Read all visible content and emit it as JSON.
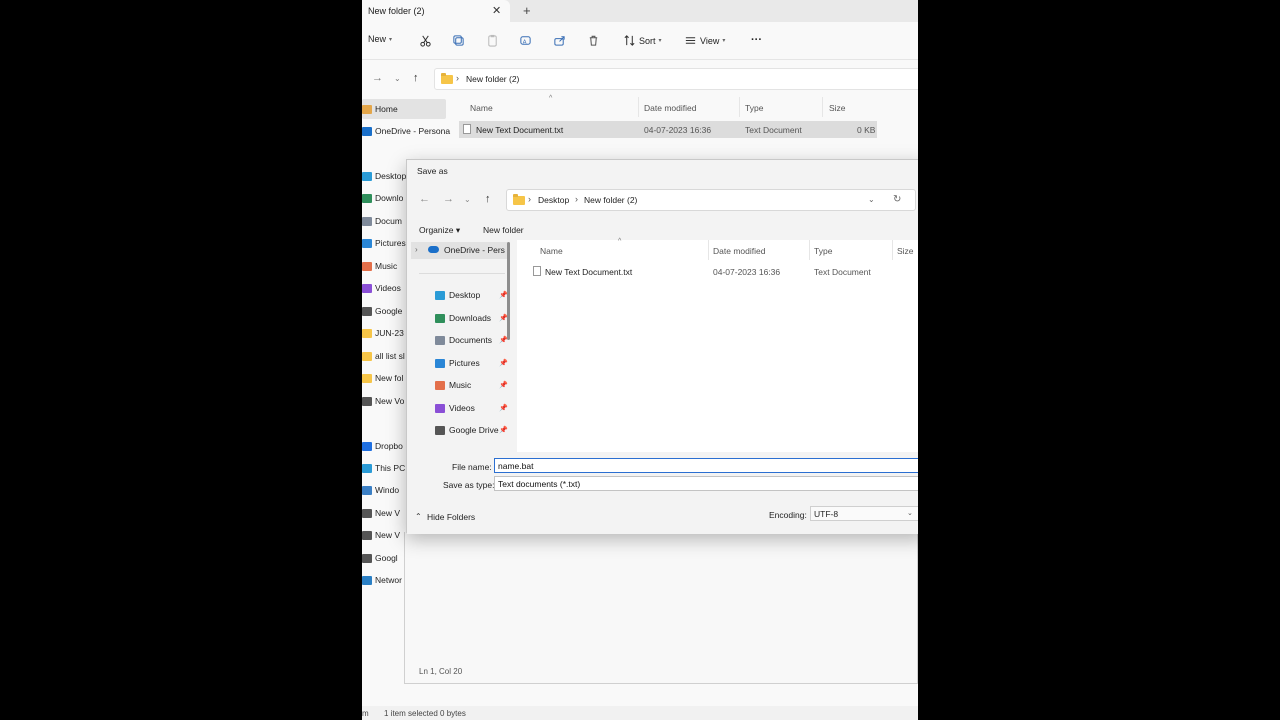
{
  "explorer": {
    "tab_title": "New folder (2)",
    "tab_close": "✕",
    "tab_add": "+",
    "toolbar": {
      "new_label": "New",
      "sort_label": "Sort",
      "view_label": "View",
      "more_label": "···"
    },
    "address": {
      "path": [
        "New folder (2)"
      ]
    },
    "nav": [
      {
        "label": "Home",
        "icon": "home-icon",
        "color": "#e3a64a"
      },
      {
        "label": "OneDrive - Persona",
        "icon": "cloud-icon",
        "color": "#1a6fc9"
      },
      {
        "label": "Desktop",
        "icon": "desktop-icon",
        "color": "#2a9bd6"
      },
      {
        "label": "Downlo",
        "icon": "download-icon",
        "color": "#2f8f5b"
      },
      {
        "label": "Docum",
        "icon": "documents-icon",
        "color": "#7f8a9a"
      },
      {
        "label": "Pictures",
        "icon": "pictures-icon",
        "color": "#2a86d6"
      },
      {
        "label": "Music",
        "icon": "music-icon",
        "color": "#e36f4a"
      },
      {
        "label": "Videos",
        "icon": "videos-icon",
        "color": "#8a4fd6"
      },
      {
        "label": "Google",
        "icon": "drive-icon",
        "color": "#555555"
      },
      {
        "label": "JUN-23",
        "icon": "folder-icon",
        "color": "#f6c548"
      },
      {
        "label": "all list sl",
        "icon": "folder-icon",
        "color": "#f6c548"
      },
      {
        "label": "New fol",
        "icon": "folder-icon",
        "color": "#f6c548"
      },
      {
        "label": "New Vo",
        "icon": "drive-icon",
        "color": "#555555"
      },
      {
        "label": "Dropbo",
        "icon": "dropbox-icon",
        "color": "#1f6fe0"
      },
      {
        "label": "This PC",
        "icon": "pc-icon",
        "color": "#2a9bd6"
      },
      {
        "label": "Windo",
        "icon": "windows-icon",
        "color": "#3b7fc4"
      },
      {
        "label": "New V",
        "icon": "drive-icon",
        "color": "#555555"
      },
      {
        "label": "New V",
        "icon": "drive-icon",
        "color": "#555555"
      },
      {
        "label": "Googl",
        "icon": "drive-icon",
        "color": "#555555"
      },
      {
        "label": "Networ",
        "icon": "network-icon",
        "color": "#2a7fc4"
      }
    ],
    "columns": [
      "Name",
      "Date modified",
      "Type",
      "Size"
    ],
    "files": [
      {
        "name": "New Text Document.txt",
        "date": "04-07-2023 16:36",
        "type": "Text Document",
        "size": "0 KB"
      }
    ],
    "status": {
      "left": "m",
      "selected": "1 item selected 0 bytes"
    }
  },
  "dialog": {
    "title": "Save as",
    "breadcrumb": [
      "Desktop",
      "New folder (2)"
    ],
    "organize_label": "Organize ▾",
    "new_folder_label": "New folder",
    "onedrive_label": "OneDrive - Pers",
    "nav": [
      {
        "label": "Desktop",
        "icon": "desktop-icon",
        "color": "#2a9bd6"
      },
      {
        "label": "Downloads",
        "icon": "download-icon",
        "color": "#2f8f5b"
      },
      {
        "label": "Documents",
        "icon": "documents-icon",
        "color": "#7f8a9a"
      },
      {
        "label": "Pictures",
        "icon": "pictures-icon",
        "color": "#2a86d6"
      },
      {
        "label": "Music",
        "icon": "music-icon",
        "color": "#e36f4a"
      },
      {
        "label": "Videos",
        "icon": "videos-icon",
        "color": "#8a4fd6"
      },
      {
        "label": "Google Drive",
        "icon": "drive-icon",
        "color": "#555555"
      }
    ],
    "columns": [
      "Name",
      "Date modified",
      "Type",
      "Size"
    ],
    "files": [
      {
        "name": "New Text Document.txt",
        "date": "04-07-2023 16:36",
        "type": "Text Document"
      }
    ],
    "file_name_label": "File name:",
    "file_name_value": "name.bat",
    "save_type_label": "Save as type:",
    "save_type_value": "Text documents (*.txt)",
    "hide_folders_label": "Hide Folders",
    "encoding_label": "Encoding:",
    "encoding_value": "UTF-8"
  },
  "notepad": {
    "position": "Ln 1, Col 20"
  }
}
